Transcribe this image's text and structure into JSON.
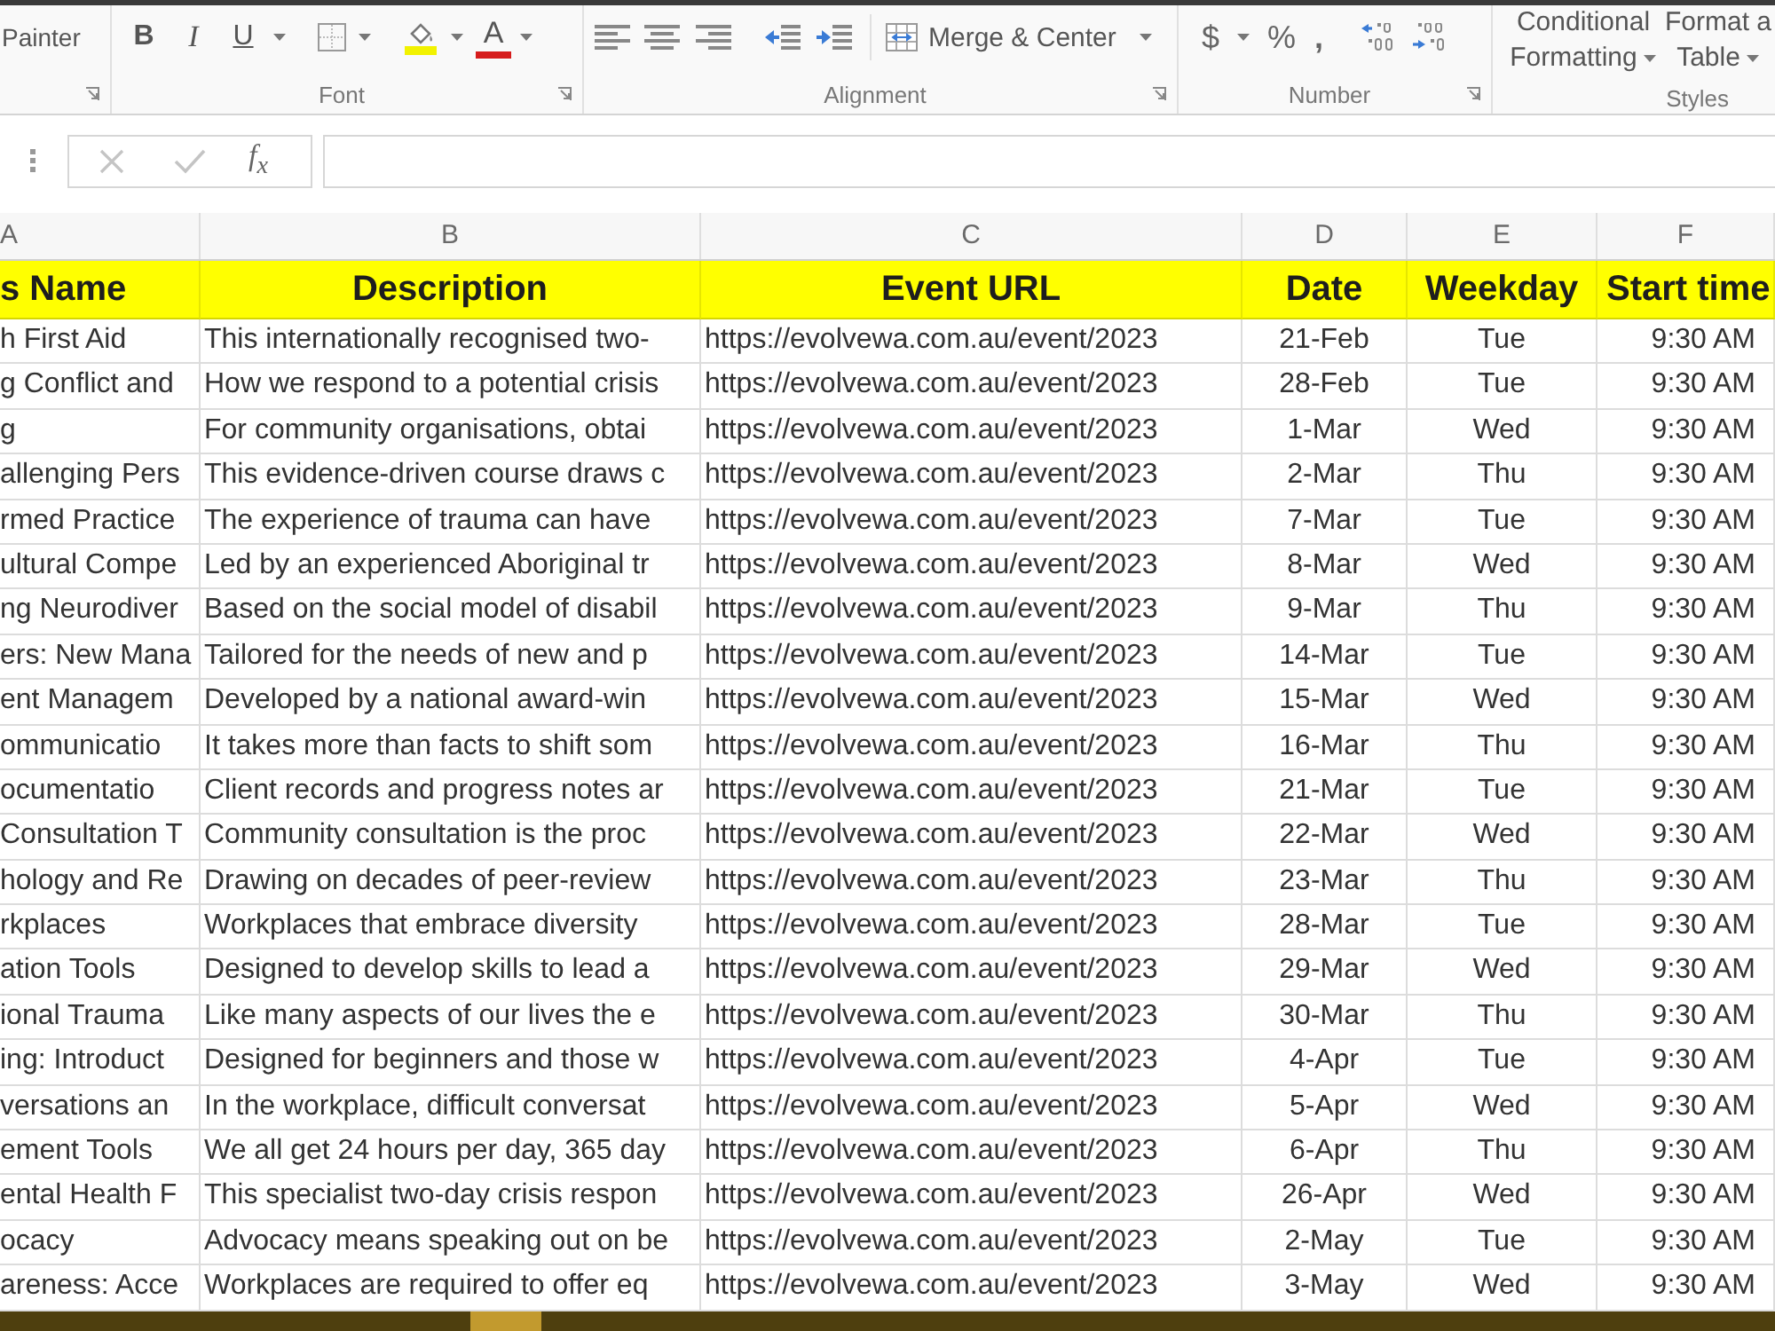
{
  "ribbon": {
    "clipboard": {
      "painter": "Painter"
    },
    "font": {
      "label": "Font",
      "bold": "B",
      "italic": "I",
      "underline": "U",
      "font_color": "A"
    },
    "alignment": {
      "label": "Alignment",
      "merge": "Merge & Center"
    },
    "number": {
      "label": "Number",
      "currency": "$",
      "percent": "%",
      "comma": ","
    },
    "styles": {
      "label": "Styles",
      "conditional_formatting": [
        "Conditional",
        "Formatting"
      ],
      "format_as_table": [
        "Format a",
        "Table"
      ]
    }
  },
  "formula_bar": {
    "function_button": "f$_{x}$"
  },
  "sheet": {
    "column_letters": [
      "A",
      "B",
      "C",
      "D",
      "E",
      "F"
    ],
    "header_row": [
      "s Name",
      "Description",
      "Event URL",
      "Date",
      "Weekday",
      "Start time"
    ],
    "rows": [
      [
        "h First Aid",
        "This internationally recognised two-",
        "https://evolvewa.com.au/event/2023",
        "21-Feb",
        "Tue",
        "9:30 AM"
      ],
      [
        "g Conflict and",
        "How we respond to a potential crisis",
        "https://evolvewa.com.au/event/2023",
        "28-Feb",
        "Tue",
        "9:30 AM"
      ],
      [
        "g",
        "For community organisations, obtai",
        "https://evolvewa.com.au/event/2023",
        "1-Mar",
        "Wed",
        "9:30 AM"
      ],
      [
        "allenging Pers",
        "This evidence-driven course draws c",
        "https://evolvewa.com.au/event/2023",
        "2-Mar",
        "Thu",
        "9:30 AM"
      ],
      [
        "rmed Practice",
        "The experience of trauma can have",
        "https://evolvewa.com.au/event/2023",
        "7-Mar",
        "Tue",
        "9:30 AM"
      ],
      [
        "ultural Compe",
        "Led by an experienced Aboriginal tr",
        "https://evolvewa.com.au/event/2023",
        "8-Mar",
        "Wed",
        "9:30 AM"
      ],
      [
        "ng Neurodiver",
        "Based on the social model of disabil",
        "https://evolvewa.com.au/event/2023",
        "9-Mar",
        "Thu",
        "9:30 AM"
      ],
      [
        "ers: New Mana",
        "Tailored for the needs of new and p",
        "https://evolvewa.com.au/event/2023",
        "14-Mar",
        "Tue",
        "9:30 AM"
      ],
      [
        "ent Managem",
        "Developed by a national award-win",
        "https://evolvewa.com.au/event/2023",
        "15-Mar",
        "Wed",
        "9:30 AM"
      ],
      [
        "ommunicatio",
        "It takes more than facts to shift som",
        "https://evolvewa.com.au/event/2023",
        "16-Mar",
        "Thu",
        "9:30 AM"
      ],
      [
        "ocumentatio",
        "Client records and progress notes ar",
        "https://evolvewa.com.au/event/2023",
        "21-Mar",
        "Tue",
        "9:30 AM"
      ],
      [
        "Consultation T",
        "Community consultation is the proc",
        "https://evolvewa.com.au/event/2023",
        "22-Mar",
        "Wed",
        "9:30 AM"
      ],
      [
        "hology and Re",
        "Drawing on decades of peer-review",
        "https://evolvewa.com.au/event/2023",
        "23-Mar",
        "Thu",
        "9:30 AM"
      ],
      [
        "rkplaces",
        "Workplaces that embrace diversity",
        "https://evolvewa.com.au/event/2023",
        "28-Mar",
        "Tue",
        "9:30 AM"
      ],
      [
        "ation Tools",
        "Designed to develop skills to lead a",
        "https://evolvewa.com.au/event/2023",
        "29-Mar",
        "Wed",
        "9:30 AM"
      ],
      [
        "ional Trauma",
        "Like many aspects of our lives the e",
        "https://evolvewa.com.au/event/2023",
        "30-Mar",
        "Thu",
        "9:30 AM"
      ],
      [
        "ing: Introduct",
        "Designed for beginners and those w",
        "https://evolvewa.com.au/event/2023",
        "4-Apr",
        "Tue",
        "9:30 AM"
      ],
      [
        "versations an",
        "In the workplace, difficult conversat",
        "https://evolvewa.com.au/event/2023",
        "5-Apr",
        "Wed",
        "9:30 AM"
      ],
      [
        "ement Tools",
        "We all get 24 hours per day, 365 day",
        "https://evolvewa.com.au/event/2023",
        "6-Apr",
        "Thu",
        "9:30 AM"
      ],
      [
        "ental Health F",
        "This specialist two-day crisis respon",
        "https://evolvewa.com.au/event/2023",
        "26-Apr",
        "Wed",
        "9:30 AM"
      ],
      [
        "ocacy",
        "Advocacy means speaking out on be",
        "https://evolvewa.com.au/event/2023",
        "2-May",
        "Tue",
        "9:30 AM"
      ],
      [
        "areness: Acce",
        "Workplaces are required to offer eq",
        "https://evolvewa.com.au/event/2023",
        "3-May",
        "Wed",
        "9:30 AM"
      ]
    ]
  }
}
